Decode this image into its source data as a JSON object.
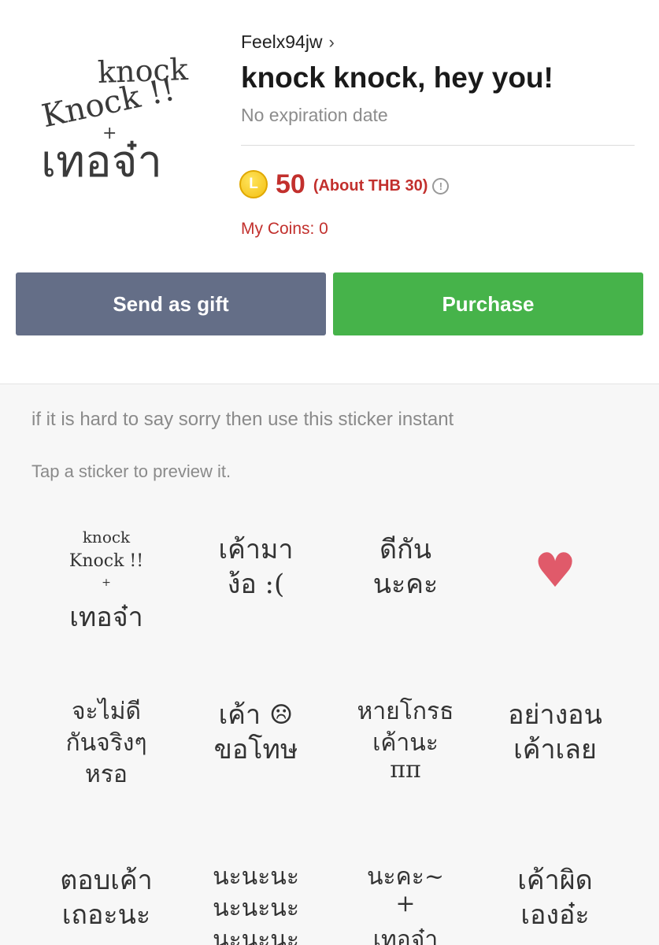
{
  "sticker_pack": {
    "author": "Feelx94jw",
    "title": "knock knock, hey you!",
    "expiry": "No expiration date",
    "main_image_lines": [
      "knock",
      "Knock !!",
      "+",
      "เทอจ๋า"
    ]
  },
  "price": {
    "coin_icon_letter": "L",
    "amount": "50",
    "approx": "(About THB 30)",
    "info_icon": "!",
    "my_coins": "My Coins: 0"
  },
  "buttons": {
    "gift": "Send as gift",
    "purchase": "Purchase"
  },
  "description": "if it is hard to say sorry then use this sticker instant",
  "preview_hint": "Tap a sticker to preview it.",
  "stickers": [
    {
      "lines": [
        "knock",
        "Knock !!",
        "+",
        "เทอจ๋า"
      ]
    },
    {
      "lines": [
        "เค้ามา",
        "ง้อ :("
      ]
    },
    {
      "lines": [
        "ดีกัน",
        "นะคะ"
      ]
    },
    {
      "lines": [
        "♥"
      ]
    },
    {
      "lines": [
        "จะไม่ดี",
        "กันจริงๆ",
        "หรอ"
      ]
    },
    {
      "lines": [
        "เค้า ☹",
        "ขอโทษ"
      ]
    },
    {
      "lines": [
        "หายโกรธ",
        "เค้านะ",
        "ππ"
      ]
    },
    {
      "lines": [
        "อย่างอน",
        "เค้าเลย"
      ]
    },
    {
      "lines": [
        "ตอบเค้า",
        "เถอะนะ"
      ]
    },
    {
      "lines": [
        "นะนะนะ",
        "นะนะนะ",
        "นะนะนะ"
      ]
    },
    {
      "lines": [
        "นะคะ~",
        "+",
        "เทอจ๋า"
      ]
    },
    {
      "lines": [
        "เค้าผิด",
        "เองอ๋ะ"
      ]
    }
  ]
}
